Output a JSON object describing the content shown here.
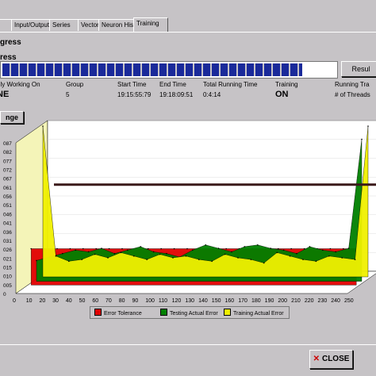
{
  "tabs": [
    "",
    "Input/Output",
    "Series",
    "Vectors",
    "Neuron Hist",
    "Training"
  ],
  "active_tab": 5,
  "progress_title": "gress",
  "progress_label": "ress",
  "progress": 0.9,
  "results_label": "Resul",
  "stats": [
    {
      "header": "nly Working On",
      "value": "NE",
      "big": true
    },
    {
      "header": "Group",
      "value": "5",
      "big": false
    },
    {
      "header": "Start Time",
      "value": "19:15:55:79",
      "big": false
    },
    {
      "header": "End Time",
      "value": "19:18:09:51",
      "big": false
    },
    {
      "header": "Total Running Time",
      "value": "0:4:14",
      "big": false
    },
    {
      "header": "Training",
      "value": "ON",
      "big": true
    },
    {
      "header": "Running Tra",
      "value": "# of Threads",
      "big": false
    }
  ],
  "range_label": "nge",
  "chart_data": {
    "type": "area",
    "y_ticks": [
      "087",
      "082",
      "077",
      "072",
      "067",
      "061",
      "056",
      "051",
      "046",
      "041",
      "036",
      "031",
      "026",
      "021",
      "015",
      "010",
      "005",
      "0"
    ],
    "x_ticks": [
      "0",
      "10",
      "20",
      "30",
      "40",
      "50",
      "60",
      "70",
      "80",
      "90",
      "100",
      "110",
      "120",
      "130",
      "140",
      "150",
      "160",
      "170",
      "180",
      "190",
      "200",
      "210",
      "220",
      "230",
      "240",
      "250"
    ],
    "series": [
      {
        "name": "Error Tolerance",
        "color": "#e00000",
        "values": [
          0.021,
          0.021,
          0.021,
          0.021,
          0.021,
          0.021,
          0.021,
          0.021,
          0.021,
          0.021,
          0.021,
          0.021,
          0.021,
          0.021,
          0.021,
          0.021,
          0.021,
          0.021,
          0.021,
          0.021,
          0.021,
          0.021,
          0.021,
          0.021,
          0.021,
          0.021
        ]
      },
      {
        "name": "Testing Actual Error",
        "color": "#008000",
        "values": [
          0.012,
          0.014,
          0.016,
          0.018,
          0.017,
          0.019,
          0.016,
          0.018,
          0.02,
          0.017,
          0.016,
          0.014,
          0.018,
          0.021,
          0.019,
          0.017,
          0.02,
          0.021,
          0.019,
          0.018,
          0.016,
          0.02,
          0.018,
          0.017,
          0.019,
          0.082
        ]
      },
      {
        "name": "Training Actual Error",
        "color": "#f0f000",
        "values": [
          0.087,
          0.012,
          0.009,
          0.01,
          0.013,
          0.011,
          0.014,
          0.012,
          0.01,
          0.013,
          0.011,
          0.012,
          0.01,
          0.009,
          0.013,
          0.011,
          0.01,
          0.008,
          0.014,
          0.012,
          0.01,
          0.009,
          0.012,
          0.011,
          0.01,
          0.087
        ]
      }
    ]
  },
  "close_label": "CLOSE"
}
